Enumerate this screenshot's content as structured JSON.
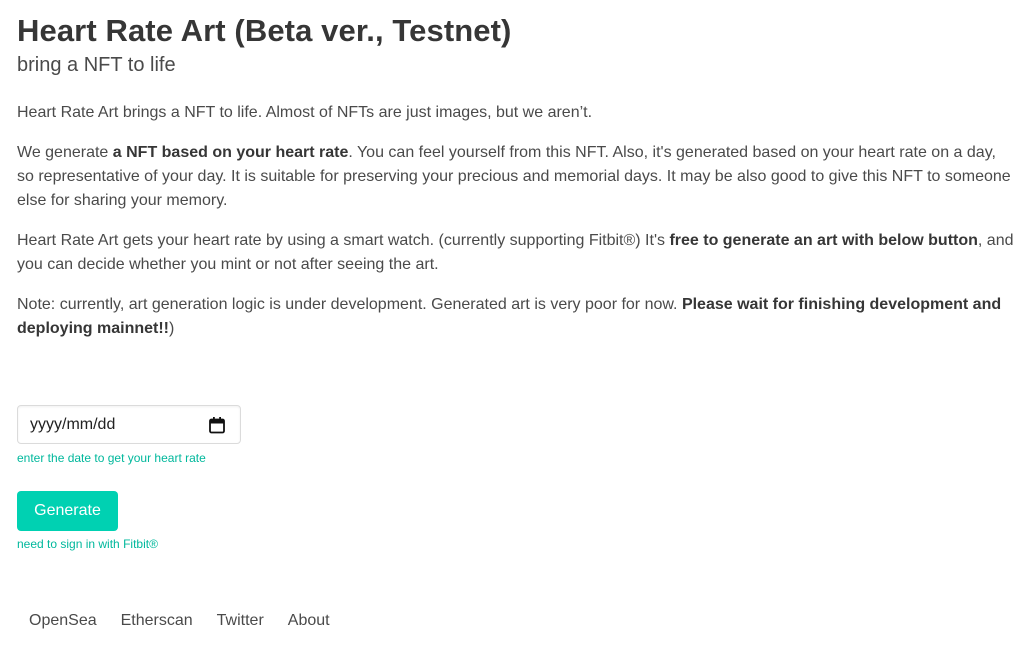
{
  "header": {
    "title": "Heart Rate Art (Beta ver., Testnet)",
    "subtitle": "bring a NFT to life"
  },
  "intro": {
    "p1": "Heart Rate Art brings a NFT to life. Almost of NFTs are just images, but we aren’t.",
    "p2_pre": "We generate ",
    "p2_bold": "a NFT based on your heart rate",
    "p2_post": ". You can feel yourself from this NFT. Also, it's generated based on your heart rate on a day, so representative of your day. It is suitable for preserving your precious and memorial days. It may be also good to give this NFT to someone else for sharing your memory.",
    "p3_pre": "Heart Rate Art gets your heart rate by using a smart watch. (currently supporting Fitbit®) It's ",
    "p3_bold": "free to generate an art with below button",
    "p3_post": ", and you can decide whether you mint or not after seeing the art.",
    "p4_pre": "Note: currently, art generation logic is under development. Generated art is very poor for now. ",
    "p4_bold": "Please wait for finishing development and deploying mainnet!!",
    "p4_post": ")"
  },
  "form": {
    "date_placeholder": "yyyy/mm/dd",
    "date_help": "enter the date to get your heart rate",
    "generate_label": "Generate",
    "generate_help": "need to sign in with Fitbit®"
  },
  "footer": {
    "links": [
      "OpenSea",
      "Etherscan",
      "Twitter",
      "About"
    ]
  },
  "colors": {
    "accent": "#00d1b2",
    "help_text": "#00b89c",
    "title": "#363636",
    "body_text": "#4a4a4a"
  },
  "icons": {
    "date_picker": "calendar-icon"
  }
}
